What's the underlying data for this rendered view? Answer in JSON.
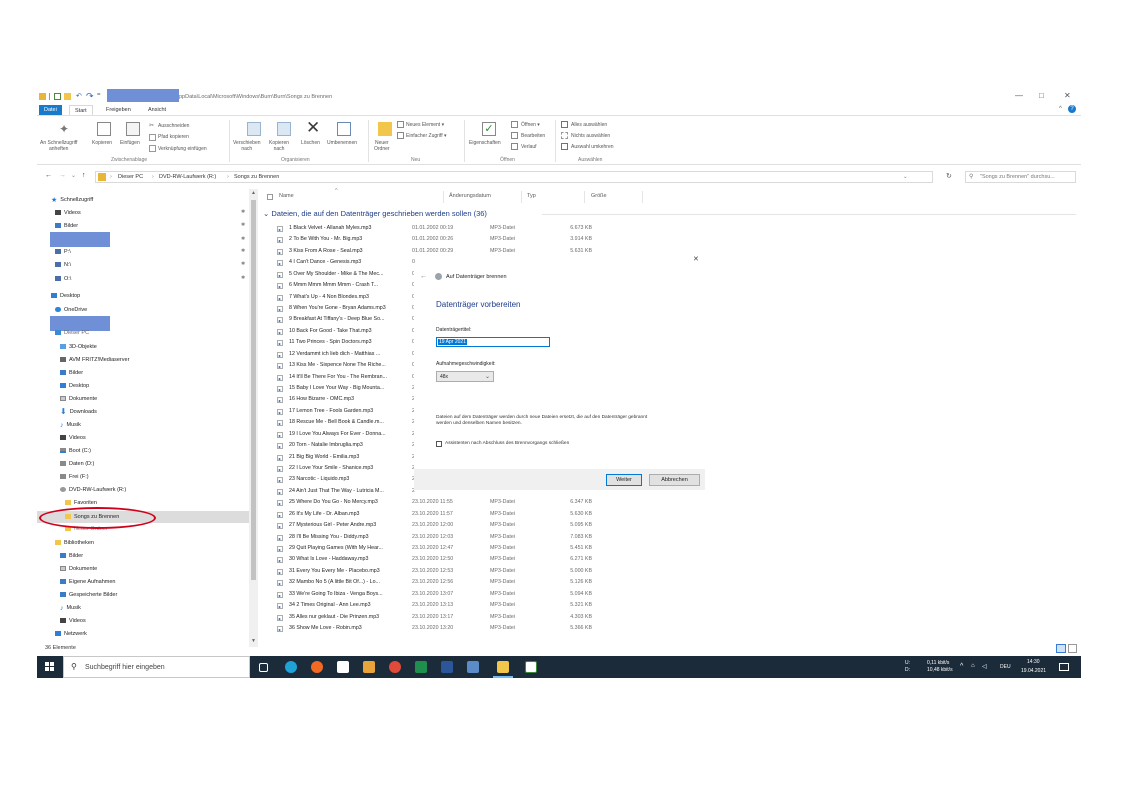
{
  "titlebar": {
    "path": "ppData\\Local\\Microsoft\\Windows\\Burn\\Burn\\Songs zu Brennen",
    "minimize": "—",
    "maximize": "□",
    "close": "✕",
    "help": "?"
  },
  "tabs": [
    "Datei",
    "Start",
    "Freigeben",
    "Ansicht"
  ],
  "ribbon": {
    "pin_quick": "An Schnellzugriff\nanheften",
    "copy": "Kopieren",
    "paste": "Einfügen",
    "cut": "Ausschneiden",
    "copy_path": "Pfad kopieren",
    "paste_link": "Verknüpfung einfügen",
    "group_clipboard": "Zwischenablage",
    "move_to": "Verschieben\nnach",
    "copy_to": "Kopieren\nnach",
    "delete": "Löschen",
    "rename": "Umbenennen",
    "group_organize": "Organisieren",
    "new_folder": "Neuer\nOrdner",
    "new_item": "Neues Element ▾",
    "easy_access": "Einfacher Zugriff ▾",
    "group_new": "Neu",
    "properties": "Eigenschaften",
    "open": "Öffnen ▾",
    "edit": "Bearbeiten",
    "history": "Verlauf",
    "group_open": "Öffnen",
    "select_all": "Alles auswählen",
    "select_none": "Nichts auswählen",
    "invert_selection": "Auswahl umkehren",
    "group_select": "Auswählen"
  },
  "address": {
    "back": "←",
    "forward": "→",
    "recent": "⌄",
    "up": "↑",
    "crumbs": [
      "Dieser PC",
      "DVD-RW-Laufwerk (R:)",
      "Songs zu Brennen"
    ],
    "search_placeholder": "\"Songs zu Brennen\" durchsu...",
    "refresh": "↻"
  },
  "nav": {
    "quick_access": "Schnellzugriff",
    "items_quick": [
      "Videos",
      "Bilder",
      "P:\\",
      "N:\\",
      "O:\\"
    ],
    "desktop": "Desktop",
    "onedrive": "OneDrive",
    "this_pc": "Dieser PC",
    "pc_items": [
      "3D-Objekte",
      "AVM FRITZ!Mediaserver",
      "Bilder",
      "Desktop",
      "Dokumente",
      "Downloads",
      "Musik",
      "Videos",
      "Boot (C:)",
      "Daten (D:)",
      "Frei (F:)",
      "DVD-RW-Laufwerk (R:)",
      "Favoriten",
      "Songs zu Brennen",
      "Neuer Ordner"
    ],
    "libraries": "Bibliotheken",
    "lib_items": [
      "Bilder",
      "Dokumente",
      "Eigene Aufnahmen",
      "Gespeicherte Bilder",
      "Musik",
      "Videos"
    ],
    "network": "Netzwerk"
  },
  "columns": {
    "name": "Name",
    "date": "Änderungsdatum",
    "type": "Typ",
    "size": "Größe"
  },
  "group_header": "Dateien, die auf den Datenträger geschrieben werden sollen (36)",
  "files": [
    {
      "name": "1 Black Velvet - Allanah Myles.mp3",
      "date": "01.01.2002 00:19",
      "type": "MP3-Datei",
      "size": "6.673 KB"
    },
    {
      "name": "2 To Be With You - Mr. Big.mp3",
      "date": "01.01.2002 00:26",
      "type": "MP3-Datei",
      "size": "3.914 KB"
    },
    {
      "name": "3 Kiss From A Rose - Seal.mp3",
      "date": "01.01.2002 00:29",
      "type": "MP3-Datei",
      "size": "5.631 KB"
    },
    {
      "name": "4 I Can't Dance - Genesis.mp3",
      "date": "0",
      "type": "",
      "size": ""
    },
    {
      "name": "5 Over My Shoulder - Mike & The Mec...",
      "date": "0",
      "type": "",
      "size": ""
    },
    {
      "name": "6 Mmm Mmm Mmm Mmm - Crash T...",
      "date": "0",
      "type": "",
      "size": ""
    },
    {
      "name": "7 What's Up - 4 Non Blondes.mp3",
      "date": "0",
      "type": "",
      "size": ""
    },
    {
      "name": "8 When You're Gone - Bryan Adams.mp3",
      "date": "0",
      "type": "",
      "size": ""
    },
    {
      "name": "9 Breakfast At Tiffany's - Deep Blue So...",
      "date": "0",
      "type": "",
      "size": ""
    },
    {
      "name": "10 Back For Good - Take That.mp3",
      "date": "0",
      "type": "",
      "size": ""
    },
    {
      "name": "11 Two Princes - Spin Doctors.mp3",
      "date": "0",
      "type": "",
      "size": ""
    },
    {
      "name": "12 Verdammt ich lieb dich - Matthias ...",
      "date": "0",
      "type": "",
      "size": ""
    },
    {
      "name": "13 Kiss Me - Sixpence None The Riche...",
      "date": "0",
      "type": "",
      "size": ""
    },
    {
      "name": "14 It'll Be There For You - The Rembran...",
      "date": "0",
      "type": "",
      "size": ""
    },
    {
      "name": "15 Baby I Love Your Way - Big Mounta...",
      "date": "2",
      "type": "",
      "size": ""
    },
    {
      "name": "16 How Bizarre - OMC.mp3",
      "date": "2",
      "type": "",
      "size": ""
    },
    {
      "name": "17 Lemon Tree - Fools Garden.mp3",
      "date": "2",
      "type": "",
      "size": ""
    },
    {
      "name": "18 Rescue Me - Bell Book & Candle.m...",
      "date": "2",
      "type": "",
      "size": ""
    },
    {
      "name": "19 I Love You Always For Ever - Donna...",
      "date": "2",
      "type": "",
      "size": ""
    },
    {
      "name": "20 Torn - Natalie Imbruglia.mp3",
      "date": "2",
      "type": "",
      "size": ""
    },
    {
      "name": "21 Big Big World - Emilia.mp3",
      "date": "2",
      "type": "",
      "size": ""
    },
    {
      "name": "22 I Love Your Smile - Shanice.mp3",
      "date": "2",
      "type": "",
      "size": ""
    },
    {
      "name": "23 Narcotic - Liquido.mp3",
      "date": "2",
      "type": "",
      "size": ""
    },
    {
      "name": "24 Ain't Just That The Way - Lutricia M...",
      "date": "2",
      "type": "",
      "size": ""
    },
    {
      "name": "25 Where Do You Go - No Mercy.mp3",
      "date": "23.10.2020 11:55",
      "type": "MP3-Datei",
      "size": "6.347 KB"
    },
    {
      "name": "26 It's My Life - Dr. Alban.mp3",
      "date": "23.10.2020 11:57",
      "type": "MP3-Datei",
      "size": "5.630 KB"
    },
    {
      "name": "27 Mysterious Girl - Peter Andre.mp3",
      "date": "23.10.2020 12:00",
      "type": "MP3-Datei",
      "size": "5.095 KB"
    },
    {
      "name": "28 I'll Be Missing You - Diddy.mp3",
      "date": "23.10.2020 12:03",
      "type": "MP3-Datei",
      "size": "7.083 KB"
    },
    {
      "name": "29 Quit Playing Games (With My Hear...",
      "date": "23.10.2020 12:47",
      "type": "MP3-Datei",
      "size": "5.451 KB"
    },
    {
      "name": "30 What Is Love - Haddaway.mp3",
      "date": "23.10.2020 12:50",
      "type": "MP3-Datei",
      "size": "6.271 KB"
    },
    {
      "name": "31 Every You Every Me - Placebo.mp3",
      "date": "23.10.2020 12:53",
      "type": "MP3-Datei",
      "size": "5.000 KB"
    },
    {
      "name": "32 Mambo No 5 (A little Bit Of...) - Lo...",
      "date": "23.10.2020 12:56",
      "type": "MP3-Datei",
      "size": "5.126 KB"
    },
    {
      "name": "33 We're Going To Ibiza - Venga Boys...",
      "date": "23.10.2020 13:07",
      "type": "MP3-Datei",
      "size": "5.094 KB"
    },
    {
      "name": "34 2 Times Original - Ann Lee.mp3",
      "date": "23.10.2020 13:13",
      "type": "MP3-Datei",
      "size": "5.321 KB"
    },
    {
      "name": "35 Alles nur geklaut - Die Prinzen.mp3",
      "date": "23.10.2020 13:17",
      "type": "MP3-Datei",
      "size": "4.303 KB"
    },
    {
      "name": "36 Show Me Love - Robin.mp3",
      "date": "23.10.2020 13:20",
      "type": "MP3-Datei",
      "size": "5.366 KB"
    }
  ],
  "status": "36 Elemente",
  "dialog": {
    "header": "Auf Datenträger brennen",
    "back": "←",
    "close": "✕",
    "heading": "Datenträger vorbereiten",
    "title_label": "Datenträgertitel:",
    "title_value": "19 Apr 2021",
    "speed_label": "Aufnahmegeschwindigkeit:",
    "speed_value": "48x",
    "info_text": "Dateien auf dem Datenträger werden durch neue Dateien ersetzt, die auf den Datenträger gebrannt werden und denselben Namen besitzen.",
    "checkbox_label": "Assistenten nach Abschluss des Brennvorgangs schließen",
    "next": "Weiter",
    "cancel": "Abbrechen"
  },
  "taskbar": {
    "search_placeholder": "Suchbegriff hier eingeben",
    "net_line1": "0,11 kbit/s",
    "net_line2": "10,48 kbit/s",
    "net_label1": "U:",
    "net_label2": "D:",
    "language": "DEU",
    "time": "14:30",
    "date": "19.04.2021",
    "tray_caret": "^"
  },
  "colors": {
    "accent": "#1979ca",
    "group_header": "#1e3d8a",
    "taskbar": "#1c2b3a",
    "redaction": "#6f8fd6",
    "highlight_circle": "#d0021b",
    "selection": "#dcdcdc"
  }
}
